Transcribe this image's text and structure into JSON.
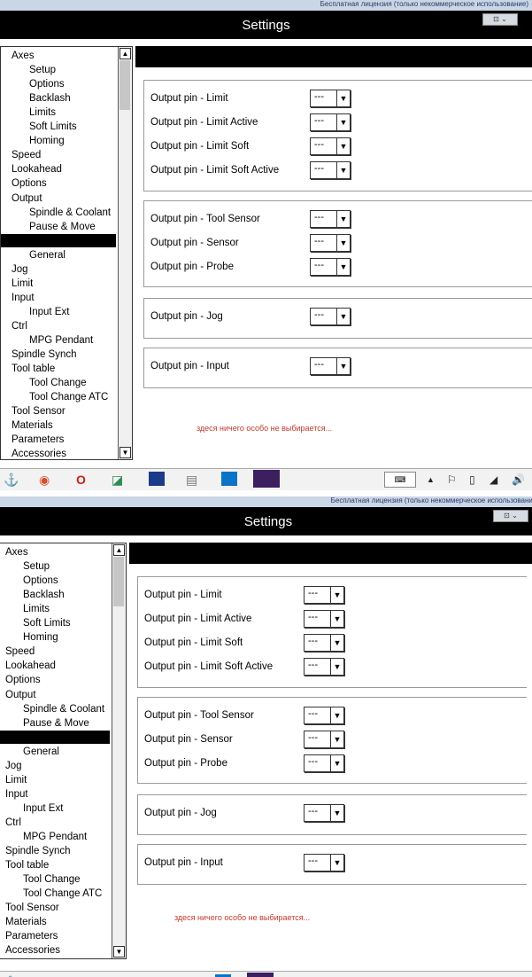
{
  "window": {
    "title": "Settings",
    "license_text": "Бесплатная лицензия (только некоммерческое использование)",
    "window_buttons": "⊡ ⌄"
  },
  "sidebar": {
    "items": [
      {
        "label": "Axes",
        "level": 0
      },
      {
        "label": "Setup",
        "level": 1
      },
      {
        "label": "Options",
        "level": 1
      },
      {
        "label": "Backlash",
        "level": 1
      },
      {
        "label": "Limits",
        "level": 1
      },
      {
        "label": "Soft Limits",
        "level": 1
      },
      {
        "label": "Homing",
        "level": 1
      },
      {
        "label": "Speed",
        "level": 0
      },
      {
        "label": "Lookahead",
        "level": 0
      },
      {
        "label": "Options",
        "level": 0
      },
      {
        "label": "Output",
        "level": 0
      },
      {
        "label": "Spindle & Coolant",
        "level": 1
      },
      {
        "label": "Pause & Move",
        "level": 1
      },
      {
        "label": "",
        "level": 1,
        "selected": true
      },
      {
        "label": "General",
        "level": 1
      },
      {
        "label": "Jog",
        "level": 0
      },
      {
        "label": "Limit",
        "level": 0
      },
      {
        "label": "Input",
        "level": 0
      },
      {
        "label": "Input Ext",
        "level": 1
      },
      {
        "label": "Ctrl",
        "level": 0
      },
      {
        "label": "MPG Pendant",
        "level": 1
      },
      {
        "label": "Spindle Synch",
        "level": 0
      },
      {
        "label": "Tool table",
        "level": 0
      },
      {
        "label": "Tool Change",
        "level": 1
      },
      {
        "label": "Tool Change ATC",
        "level": 1
      },
      {
        "label": "Tool Sensor",
        "level": 0
      },
      {
        "label": "Materials",
        "level": 0
      },
      {
        "label": "Parameters",
        "level": 0
      },
      {
        "label": "Accessories",
        "level": 0
      }
    ],
    "scroll_up": "▲",
    "scroll_down": "▼"
  },
  "groups": [
    {
      "rows": [
        {
          "label": "Output pin - Limit",
          "value": "---"
        },
        {
          "label": "Output pin - Limit Active",
          "value": "---"
        },
        {
          "label": "Output pin - Limit Soft",
          "value": "---"
        },
        {
          "label": "Output pin - Limit Soft Active",
          "value": "---"
        }
      ]
    },
    {
      "rows": [
        {
          "label": "Output pin - Tool Sensor",
          "value": "---"
        },
        {
          "label": "Output pin - Sensor",
          "value": "---"
        },
        {
          "label": "Output pin - Probe",
          "value": "---"
        }
      ]
    },
    {
      "rows": [
        {
          "label": "Output pin - Jog",
          "value": "---"
        }
      ]
    },
    {
      "rows": [
        {
          "label": "Output pin - Input",
          "value": "---"
        }
      ]
    }
  ],
  "dropdown_arrow": "▼",
  "note": "здеся ничего особо не выбирается...",
  "taskbar": {
    "apps": [
      "tool-app-icon",
      "chrome-icon",
      "opera-icon",
      "eraser-app-icon",
      "terminal-icon",
      "explorer-icon",
      "teamviewer-icon",
      "cnc-app-icon"
    ],
    "tray_up_arrow": "▲",
    "tray_glyphs": [
      "⚐",
      "▯",
      "◢",
      "🔊"
    ]
  },
  "colors": {
    "header_black": "#000000",
    "note_red": "#c0392b",
    "license_strip": "#c9d6e6"
  }
}
